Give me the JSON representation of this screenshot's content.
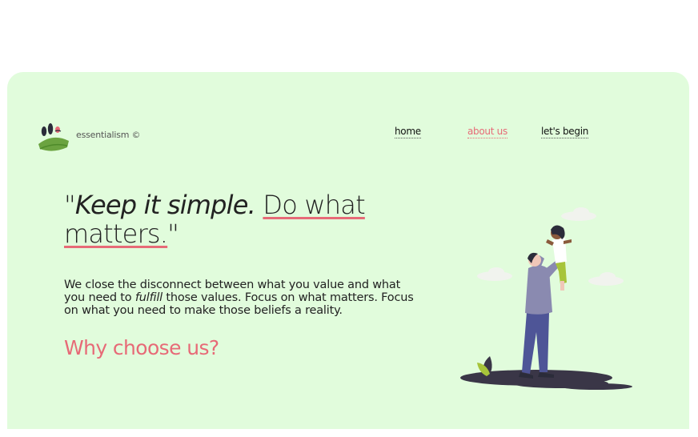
{
  "brand": {
    "name": "essentialism ©"
  },
  "nav": {
    "items": [
      "home",
      "about us",
      "let's begin"
    ]
  },
  "hero": {
    "quote_open": "\"",
    "quote_italic": "Keep it simple.",
    "quote_underlined_1": "Do what",
    "quote_underlined_2": "matters.",
    "quote_close": "\""
  },
  "description": {
    "part1": "We close the disconnect between what you value and what you need to ",
    "emphasis": "fulfill",
    "part2": " those values. Focus on what matters. Focus on what you need to make those beliefs a reality."
  },
  "cta_heading": "Why choose us?",
  "colors": {
    "background": "#e1fcdc",
    "accent": "#e76a77",
    "text": "#222222"
  },
  "icons": {
    "logo": "seeds-on-hill-logo",
    "illustration": "father-lifting-child"
  }
}
